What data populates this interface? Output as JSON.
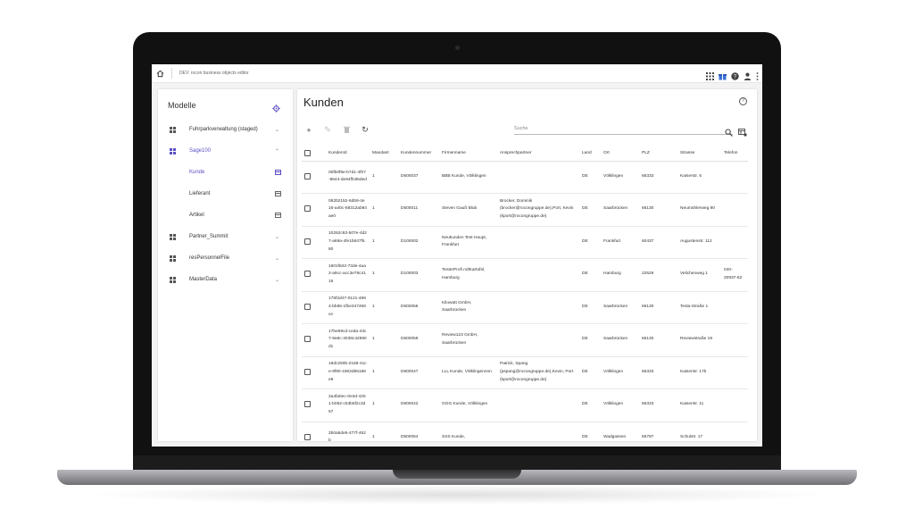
{
  "app": {
    "title": "DEV: rocon business objects editor"
  },
  "sidebar": {
    "title": "Modelle",
    "items": [
      {
        "label": "Fuhrparkverwaltung (staged)",
        "expanded": false,
        "active": false
      },
      {
        "label": "Sage100",
        "expanded": true,
        "active": true
      },
      {
        "label": "Partner_Summit",
        "expanded": false,
        "active": false
      },
      {
        "label": "resPersonnelFile",
        "expanded": false,
        "active": false
      },
      {
        "label": "MasterData",
        "expanded": false,
        "active": false
      }
    ],
    "subitems": [
      {
        "label": "Kunde",
        "active": true
      },
      {
        "label": "Lieferant",
        "active": false
      },
      {
        "label": "Artikel",
        "active": false
      }
    ]
  },
  "main": {
    "title": "Kunden",
    "search_placeholder": "Suche",
    "columns": [
      "KundenId",
      "Mandant",
      "Kundennummer",
      "Firmenname",
      "Ansprechpartner",
      "Land",
      "Ort",
      "PLZ",
      "Strasse",
      "Telefon"
    ],
    "rows": [
      [
        "00fb0f9e-b7d1-4f07-8644-de84ffc85ded",
        "1",
        "D600037",
        "BBB Kunde, Völklingen",
        "",
        "DE",
        "Völklingen",
        "66333",
        "Kaiserstr. 6",
        ""
      ],
      [
        "082b2152-6d59-4e16-a40c-68312ab84ae0",
        "1",
        "D600011",
        "Steven Gauß Blub",
        "Brocker, Dominik (brocker@rocongruppe.de),Port, Kevin (kport@rocongruppe.de)",
        "DE",
        "Saarbrücken",
        "66130",
        "Neumühlerweg 90",
        ""
      ],
      [
        "10252c63-507e-4d27-a69a-4fe1b847f580",
        "1",
        "D100002",
        "Neukunden Test Haupt, Frankfurt",
        "",
        "DE",
        "Frankfurt",
        "60437",
        "Augustenstr. 112",
        ""
      ],
      [
        "1601f842-73de-4aa2-a9cc-acc3e78c4116",
        "1",
        "D100003",
        "TesterProfi rollKartofel, Hamburg",
        "",
        "DE",
        "Hamburg",
        "22529",
        "Velichenweg 1",
        "040-20937-62"
      ],
      [
        "175f2d47-0121-4894-bb65-1fbe347468ce",
        "1",
        "D600056",
        "Kilowatt GmbH, Saarbrücken",
        "",
        "DE",
        "Saarbrücken",
        "66130",
        "Tesla-Straße 1",
        ""
      ],
      [
        "17be69cd-ceda-43c7-9a9c-3038c42990d1",
        "1",
        "D600059",
        "Review123 GmbH, Saarbrücken",
        "",
        "DE",
        "Saarbrücken",
        "66130",
        "Reviewstraße 19",
        ""
      ],
      [
        "18dc250b-2168-41ce-9f90-1902d95186e9",
        "1",
        "D600047",
        "LLL Kunde, Völklingennnn",
        "Patrick, Spang (pspang@rocongruppe.de),Kevin, Port (kport@rocongruppe.de)",
        "DE",
        "Völklingen",
        "66333",
        "Kaiserstr. 17b",
        ""
      ],
      [
        "2a4fa0ec-0e3d-4251-b062-c53b5f2c3d57",
        "1",
        "D600042",
        "GGG Kunde, Völklingen",
        "",
        "DE",
        "Völklingen",
        "66333",
        "Kaiserstr. 11",
        ""
      ],
      [
        "2b0a5de5-477f-462b",
        "1",
        "D600054",
        "SSS Kunde,",
        "",
        "DE",
        "Wadgassen",
        "66787",
        "Schulstr. 17",
        ""
      ]
    ]
  }
}
